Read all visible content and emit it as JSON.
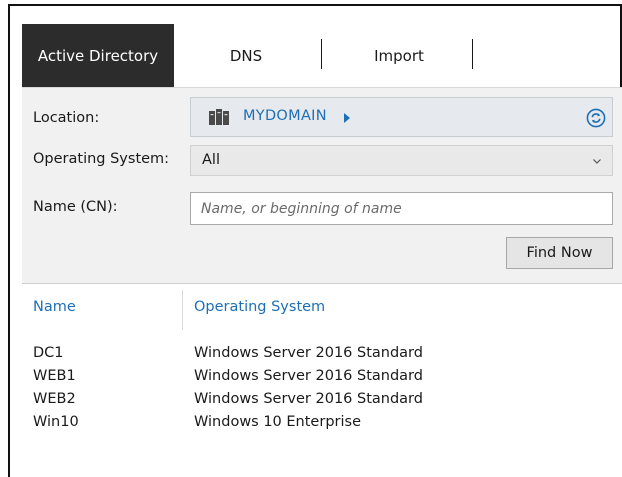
{
  "tabs": [
    {
      "label": "Active Directory",
      "active": true
    },
    {
      "label": "DNS",
      "active": false
    },
    {
      "label": "Import",
      "active": false
    }
  ],
  "search": {
    "location_label": "Location:",
    "location_value": "MYDOMAIN",
    "location_icon": "server-icon",
    "refresh_icon": "refresh-icon",
    "os_label": "Operating System:",
    "os_value": "All",
    "name_label": "Name (CN):",
    "name_placeholder": "Name, or beginning of name",
    "name_value": "",
    "find_button": "Find Now"
  },
  "results": {
    "columns": [
      "Name",
      "Operating System"
    ],
    "rows": [
      [
        "DC1",
        "Windows Server 2016 Standard"
      ],
      [
        "WEB1",
        "Windows Server 2016 Standard"
      ],
      [
        "WEB2",
        "Windows Server 2016 Standard"
      ],
      [
        "Win10",
        "Windows 10 Enterprise"
      ]
    ]
  },
  "colors": {
    "active_tab_bg": "#2c2c2c",
    "accent": "#1e6fb5",
    "panel_bg": "#f1f1f1"
  }
}
